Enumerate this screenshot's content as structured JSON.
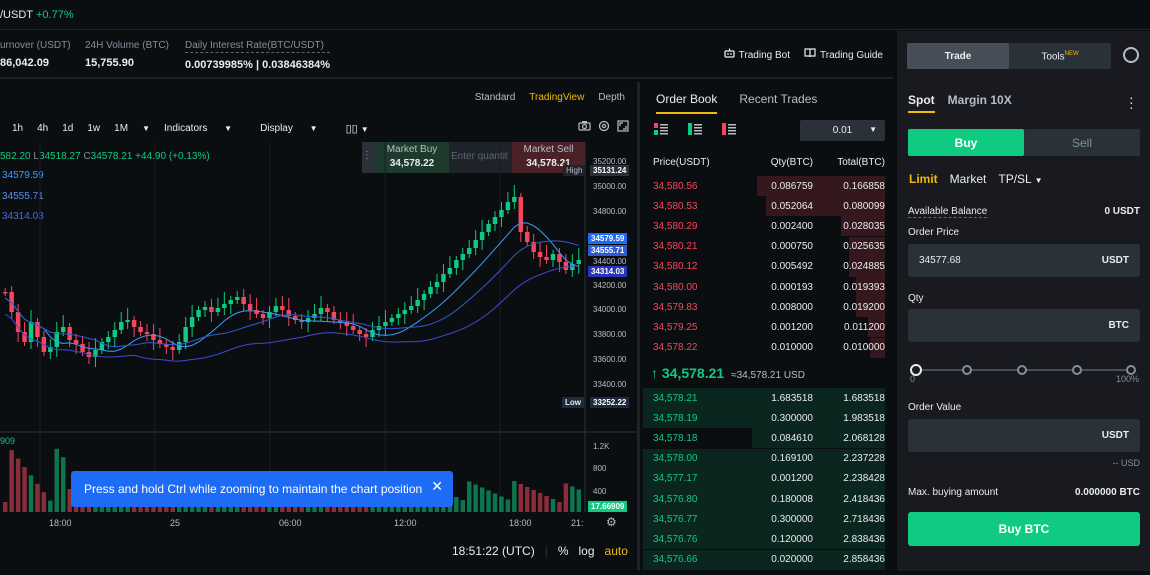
{
  "topbar": {
    "pair": "/USDT",
    "change": "+0.77%"
  },
  "stats": {
    "turnover": {
      "label": "urnover (USDT)",
      "value": "86,042.09"
    },
    "volume": {
      "label": "24H Volume (BTC)",
      "value": "15,755.90"
    },
    "interest": {
      "label": "Daily Interest Rate(BTC/USDT)",
      "value": "0.00739985% | 0.03846384%"
    },
    "links": {
      "bot": "Trading Bot",
      "guide": "Trading Guide"
    }
  },
  "chart": {
    "view_tabs": [
      "Standard",
      "TradingView",
      "Depth"
    ],
    "active_view": "TradingView",
    "timeframes": [
      "1h",
      "4h",
      "1d",
      "1w",
      "1M"
    ],
    "indicators": "Indicators",
    "display": "Display",
    "ohlc": {
      "l": "582.20",
      "lbl_l": "L",
      "low": "34518.27",
      "lbl_c": "C",
      "close": "34578.21",
      "change": "+44.90 (+0.13%)"
    },
    "ma_labels": [
      "34579.59",
      "34555.71",
      "34314.03"
    ],
    "market_buy": {
      "label": "Market Buy",
      "price": "34,578.22"
    },
    "qty_placeholder": "Enter quantit",
    "market_sell": {
      "label": "Market Sell",
      "price": "34,578.21"
    },
    "y_ticks": [
      "35200.00",
      "35000.00",
      "34800.00",
      "34400.00",
      "34200.00",
      "34000.00",
      "33800.00",
      "33600.00",
      "33400.00"
    ],
    "tags": {
      "high_label": "High",
      "high": "35131.24",
      "ma1": "34579.59",
      "ma2": "34555.71",
      "ma3": "34314.03",
      "low_label": "Low",
      "low": "33252.22"
    },
    "vol_label": "909",
    "vol_ticks": [
      "1.2K",
      "800",
      "400"
    ],
    "vol_current": "17.66909",
    "x_ticks": [
      "18:00",
      "25",
      "06:00",
      "12:00",
      "18:00",
      "21:"
    ],
    "toast": "Press and hold Ctrl while zooming to maintain the chart position",
    "time": "18:51:22 (UTC)",
    "foot": [
      "%",
      "log",
      "auto"
    ]
  },
  "orderbook": {
    "tabs": [
      "Order Book",
      "Recent Trades"
    ],
    "precision": "0.01",
    "headers": [
      "Price(USDT)",
      "Qty(BTC)",
      "Total(BTC)"
    ],
    "asks": [
      [
        "34,580.56",
        "0.086759",
        "0.166858"
      ],
      [
        "34,580.53",
        "0.052064",
        "0.080099"
      ],
      [
        "34,580.29",
        "0.002400",
        "0.028035"
      ],
      [
        "34,580.21",
        "0.000750",
        "0.025635"
      ],
      [
        "34,580.12",
        "0.005492",
        "0.024885"
      ],
      [
        "34,580.00",
        "0.000193",
        "0.019393"
      ],
      [
        "34,579.83",
        "0.008000",
        "0.019200"
      ],
      [
        "34,579.25",
        "0.001200",
        "0.011200"
      ],
      [
        "34,578.22",
        "0.010000",
        "0.010000"
      ]
    ],
    "mid_price": "34,578.21",
    "mid_sub": "≈34,578.21 USD",
    "bids": [
      [
        "34,578.21",
        "1.683518",
        "1.683518"
      ],
      [
        "34,578.19",
        "0.300000",
        "1.983518"
      ],
      [
        "34,578.18",
        "0.084610",
        "2.068128"
      ],
      [
        "34,578.00",
        "0.169100",
        "2.237228"
      ],
      [
        "34,577.17",
        "0.001200",
        "2.238428"
      ],
      [
        "34,576.80",
        "0.180008",
        "2.418436"
      ],
      [
        "34,576.77",
        "0.300000",
        "2.718436"
      ],
      [
        "34,576.76",
        "0.120000",
        "2.838436"
      ],
      [
        "34,576.66",
        "0.020000",
        "2.858436"
      ]
    ],
    "ask_depth": [
      0.53,
      0.49,
      0.18,
      0.15,
      0.15,
      0.12,
      0.12,
      0.07,
      0.06
    ],
    "bid_depth": [
      1.0,
      1.0,
      0.55,
      1.0,
      1.0,
      1.0,
      1.0,
      1.0,
      1.0
    ]
  },
  "trade": {
    "tabs": [
      "Trade",
      "Tools"
    ],
    "tools_badge": "NEW",
    "modes": [
      "Spot",
      "Margin 10X"
    ],
    "buy": "Buy",
    "sell": "Sell",
    "order_types": [
      "Limit",
      "Market",
      "TP/SL"
    ],
    "available_label": "Available Balance",
    "available_value": "0 USDT",
    "order_price_label": "Order Price",
    "order_price": "34577.68",
    "price_unit": "USDT",
    "qty_label": "Qty",
    "qty_unit": "BTC",
    "slider_min": "0",
    "slider_max": "100%",
    "order_value_label": "Order Value",
    "value_unit": "USDT",
    "value_est": "-- USD",
    "max_label": "Max. buying amount",
    "max_value": "0.000000 BTC",
    "submit": "Buy BTC"
  },
  "colors": {
    "up": "#0ecb81",
    "down": "#f6465d",
    "accent": "#f0b90b",
    "blue": "#1e6cf5"
  }
}
